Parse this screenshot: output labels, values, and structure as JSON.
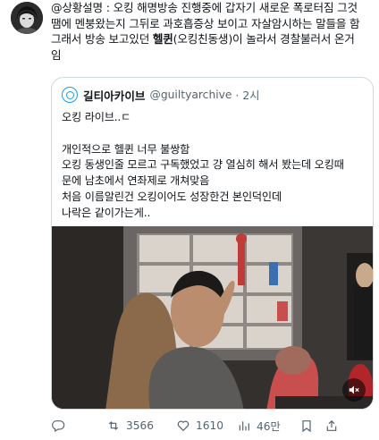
{
  "tweet": {
    "lines": [
      "@상황설명 : 오킹 해명방송 진행중에 갑자기 새로운 폭로터짐 그것",
      "땜에 멘붕왔는지 그뒤로 과호흡증상 보이고 자살암시하는 말들을 함",
      "그래서 방송 보고있던 ",
      "(오킹친동생)이 놀라서 경찰불러서 온거",
      "임"
    ],
    "bold_name": "헬퀸"
  },
  "quote": {
    "name": "길티아카이브",
    "handle": "@guiltyarchive",
    "time": "· 2시",
    "lines": [
      "오킹 라이브..ㄷ",
      "개인적으로 헬퀸 너무 불쌍함",
      "오킹 동생인줄 모르고 구독했었고 걍 열심히 해서 봤는데 오킹때",
      "문에 남초에서 연좌제로 개쳐맞음",
      "처음 이름알린건 오킹이어도 성장한건 본인덕인데",
      "나락은 같이가는게.."
    ]
  },
  "actions": {
    "replies": "",
    "retweets": "3566",
    "likes": "1610",
    "views": "46만"
  },
  "icons": {
    "reply": "reply-icon",
    "retweet": "retweet-icon",
    "like": "like-icon",
    "views": "views-icon",
    "bookmark": "bookmark-icon",
    "share": "share-icon",
    "mute": "mute-icon"
  },
  "colors": {
    "text": "#0f1419",
    "muted": "#536471",
    "accent": "#1d9bf0",
    "border": "#cfd9de"
  }
}
